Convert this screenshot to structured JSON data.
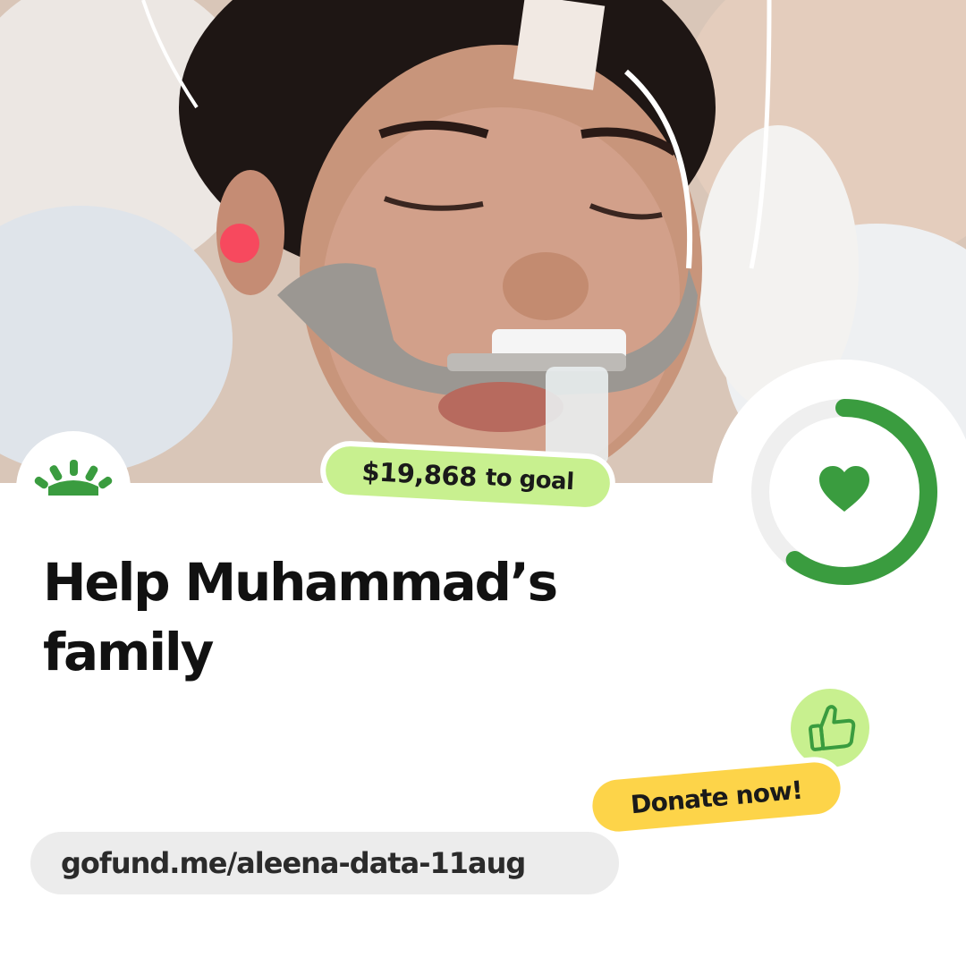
{
  "photo": {
    "subject": "child-in-hospital-bed"
  },
  "brand": {
    "logo_icon": "gofundme-sunrise-icon",
    "accent_color": "#3a9c3f"
  },
  "goal": {
    "amount": "$19,868",
    "suffix": "to goal",
    "pill_color": "#c8f08f"
  },
  "progress": {
    "fraction": 0.6,
    "ring_color": "#3a9c3f",
    "track_color": "#efefef",
    "center_icon": "heart-icon"
  },
  "campaign": {
    "title_line1": "Help Muhammad’s",
    "title_line2": "family"
  },
  "cta": {
    "label": "Donate now!",
    "color": "#fdd449",
    "badge_icon": "thumbs-up-icon",
    "badge_color": "#c8f08f"
  },
  "link": {
    "url": "gofund.me/aleena-data-11aug"
  }
}
